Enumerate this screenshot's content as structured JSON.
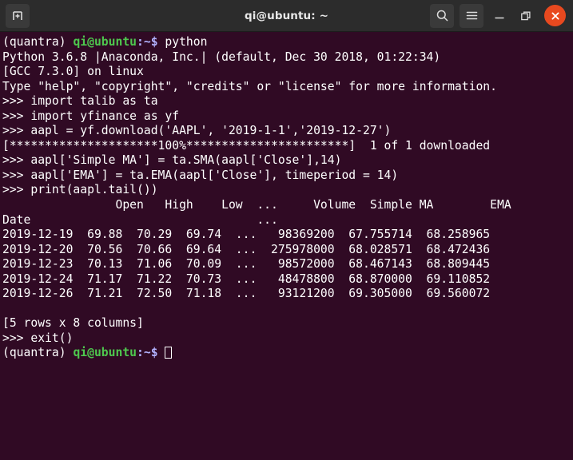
{
  "titlebar": {
    "title": "qi@ubuntu: ~",
    "new_tab_label": "new-tab",
    "search_label": "Search",
    "menu_label": "Menu",
    "minimize_label": "Minimize",
    "maximize_label": "Restore",
    "close_label": "Close",
    "bg_color": "#2c2c2c",
    "close_color": "#e8491f"
  },
  "terminal": {
    "bg_color": "#300a24",
    "fg_color": "#ffffff",
    "prompt_user_color": "#4ec84e",
    "prompt_path_color": "#b2b2ff",
    "env_name": "(quantra)",
    "user_host": "qi@ubuntu",
    "path_sign": ":~$",
    "lines": {
      "cmd_python": " python",
      "py_version": "Python 3.6.8 |Anaconda, Inc.| (default, Dec 30 2018, 01:22:34)",
      "py_gcc": "[GCC 7.3.0] on linux",
      "py_help": "Type \"help\", \"copyright\", \"credits\" or \"license\" for more information.",
      "in_import_talib": ">>> import talib as ta",
      "in_import_yfinance": ">>> import yfinance as yf",
      "in_download": ">>> aapl = yf.download('AAPL', '2019-1-1','2019-12-27')",
      "progress_bar": "[*********************100%***********************]  1 of 1 downloaded",
      "in_sma": ">>> aapl['Simple MA'] = ta.SMA(aapl['Close'],14)",
      "in_ema": ">>> aapl['EMA'] = ta.EMA(aapl['Close'], timeperiod = 14)",
      "in_print": ">>> print(aapl.tail())",
      "table_header": "                Open   High    Low  ...     Volume  Simple MA        EMA",
      "table_index_label": "Date                                ...",
      "row_1": "2019-12-19  69.88  70.29  69.74  ...   98369200  67.755714  68.258965",
      "row_2": "2019-12-20  70.56  70.66  69.64  ...  275978000  68.028571  68.472436",
      "row_3": "2019-12-23  70.13  71.06  70.09  ...   98572000  68.467143  68.809445",
      "row_4": "2019-12-24  71.17  71.22  70.73  ...   48478800  68.870000  69.110852",
      "row_5": "2019-12-26  71.21  72.50  71.18  ...   93121200  69.305000  69.560072",
      "blank": "",
      "shape_note": "[5 rows x 8 columns]",
      "in_exit": ">>> exit()"
    },
    "table": {
      "columns": [
        "Open",
        "High",
        "Low",
        "...",
        "Volume",
        "Simple MA",
        "EMA"
      ],
      "index_name": "Date",
      "rows": [
        {
          "Date": "2019-12-19",
          "Open": "69.88",
          "High": "70.29",
          "Low": "69.74",
          "ellipsis": "...",
          "Volume": "98369200",
          "Simple MA": "67.755714",
          "EMA": "68.258965"
        },
        {
          "Date": "2019-12-20",
          "Open": "70.56",
          "High": "70.66",
          "Low": "69.64",
          "ellipsis": "...",
          "Volume": "275978000",
          "Simple MA": "68.028571",
          "EMA": "68.472436"
        },
        {
          "Date": "2019-12-23",
          "Open": "70.13",
          "High": "71.06",
          "Low": "70.09",
          "ellipsis": "...",
          "Volume": "98572000",
          "Simple MA": "68.467143",
          "EMA": "68.809445"
        },
        {
          "Date": "2019-12-24",
          "Open": "71.17",
          "High": "71.22",
          "Low": "70.73",
          "ellipsis": "...",
          "Volume": "48478800",
          "Simple MA": "68.870000",
          "EMA": "69.110852"
        },
        {
          "Date": "2019-12-26",
          "Open": "71.21",
          "High": "72.50",
          "Low": "71.18",
          "ellipsis": "...",
          "Volume": "93121200",
          "Simple MA": "69.305000",
          "EMA": "69.560072"
        }
      ],
      "shape": "[5 rows x 8 columns]"
    }
  }
}
